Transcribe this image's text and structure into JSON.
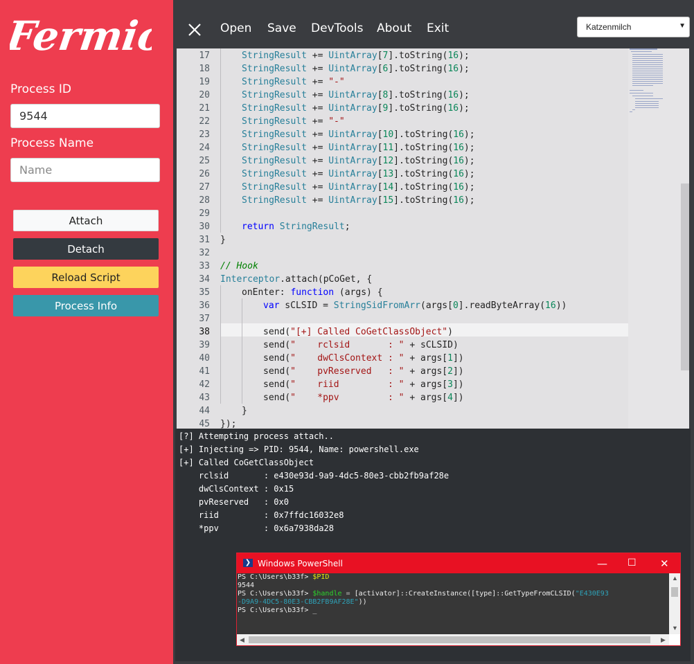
{
  "sidebar": {
    "logo_text": "Fermion",
    "pid_label": "Process ID",
    "pid_value": "9544",
    "name_label": "Process Name",
    "name_placeholder": "Name",
    "attach": "Attach",
    "detach": "Detach",
    "reload": "Reload Script",
    "info": "Process Info"
  },
  "topbar": {
    "open": "Open",
    "save": "Save",
    "devtools": "DevTools",
    "about": "About",
    "exit": "Exit",
    "theme": "Katzenmilch"
  },
  "editor": {
    "lines": [
      {
        "n": "17",
        "indent": 1,
        "code": "StringResult += UintArray[7].toString(16);"
      },
      {
        "n": "18",
        "indent": 1,
        "code": "StringResult += UintArray[6].toString(16);"
      },
      {
        "n": "19",
        "indent": 1,
        "code": "StringResult += \"-\""
      },
      {
        "n": "20",
        "indent": 1,
        "code": "StringResult += UintArray[8].toString(16);"
      },
      {
        "n": "21",
        "indent": 1,
        "code": "StringResult += UintArray[9].toString(16);"
      },
      {
        "n": "22",
        "indent": 1,
        "code": "StringResult += \"-\""
      },
      {
        "n": "23",
        "indent": 1,
        "code": "StringResult += UintArray[10].toString(16);"
      },
      {
        "n": "24",
        "indent": 1,
        "code": "StringResult += UintArray[11].toString(16);"
      },
      {
        "n": "25",
        "indent": 1,
        "code": "StringResult += UintArray[12].toString(16);"
      },
      {
        "n": "26",
        "indent": 1,
        "code": "StringResult += UintArray[13].toString(16);"
      },
      {
        "n": "27",
        "indent": 1,
        "code": "StringResult += UintArray[14].toString(16);"
      },
      {
        "n": "28",
        "indent": 1,
        "code": "StringResult += UintArray[15].toString(16);"
      },
      {
        "n": "29",
        "indent": 0,
        "code": ""
      },
      {
        "n": "30",
        "indent": 1,
        "code": "return StringResult;"
      },
      {
        "n": "31",
        "indent": 0,
        "code": "}"
      },
      {
        "n": "32",
        "indent": 0,
        "code": ""
      },
      {
        "n": "33",
        "indent": 0,
        "code": "// Hook"
      },
      {
        "n": "34",
        "indent": 0,
        "code": "Interceptor.attach(pCoGet, {"
      },
      {
        "n": "35",
        "indent": 1,
        "code": "onEnter: function (args) {"
      },
      {
        "n": "36",
        "indent": 2,
        "code": "var sCLSID = StringSidFromArr(args[0].readByteArray(16))"
      },
      {
        "n": "37",
        "indent": 0,
        "code": ""
      },
      {
        "n": "38",
        "indent": 2,
        "code": "send(\"[+] Called CoGetClassObject\")"
      },
      {
        "n": "39",
        "indent": 2,
        "code": "send(\"    rclsid       : \" + sCLSID)"
      },
      {
        "n": "40",
        "indent": 2,
        "code": "send(\"    dwClsContext : \" + args[1])"
      },
      {
        "n": "41",
        "indent": 2,
        "code": "send(\"    pvReserved   : \" + args[2])"
      },
      {
        "n": "42",
        "indent": 2,
        "code": "send(\"    riid         : \" + args[3])"
      },
      {
        "n": "43",
        "indent": 2,
        "code": "send(\"    *ppv         : \" + args[4])"
      },
      {
        "n": "44",
        "indent": 1,
        "code": "}"
      },
      {
        "n": "45",
        "indent": 0,
        "code": "});"
      }
    ]
  },
  "console": {
    "lines": [
      "[?] Attempting process attach..",
      "[+] Injecting => PID: 9544, Name: powershell.exe",
      "[+] Called CoGetClassObject",
      "    rclsid       : e430e93d-9a9-4dc5-80e3-cbb2fb9af28e",
      "    dwClsContext : 0x15",
      "    pvReserved   : 0x0",
      "    riid         : 0x7ffdc16032e8",
      "    *ppv         : 0x6a7938da28"
    ]
  },
  "powershell": {
    "title": "Windows PowerShell",
    "prompt": "PS C:\\Users\\b33f> ",
    "cmd1": "$PID",
    "out1": "9544",
    "cmd2_var": "$handle",
    "cmd2_eq": " = ",
    "cmd2_rest": "[activator]::CreateInstance([type]::GetTypeFromCLSID(",
    "cmd2_str1": "\"E430E93",
    "cmd2_str2": "-D9A9-4DC5-80E3-CBB2FB9AF28E\"",
    "cmd2_end": "))",
    "cursor": "_"
  }
}
